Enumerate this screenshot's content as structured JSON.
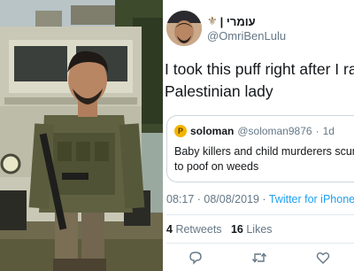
{
  "profile": {
    "display_name": "עומרי |",
    "name_decoration": "⚜",
    "handle": "@OmriBenLulu"
  },
  "tweet": {
    "line1": "I took this puff right after I raped",
    "line2": "Palestinian lady"
  },
  "quoted_tweet": {
    "avatar_letter": "P",
    "name": "soloman",
    "handle": "@soloman9876",
    "separator": "·",
    "time": "1d",
    "line1": "Baby killers and child murderers scum",
    "line2": "to poof on weeds"
  },
  "meta": {
    "timestamp": "08:17 · 08/08/2019 ·",
    "source": "Twitter for iPhone"
  },
  "stats": {
    "retweets_count": "4",
    "retweets_label": "Retweets",
    "likes_count": "16",
    "likes_label": "Likes"
  },
  "actions": {
    "reply_icon": "reply-icon",
    "retweet_icon": "retweet-icon",
    "like_icon": "heart-icon"
  },
  "colors": {
    "link": "#1da1f2",
    "secondary_text": "#657786",
    "border": "#e1e8ed"
  }
}
